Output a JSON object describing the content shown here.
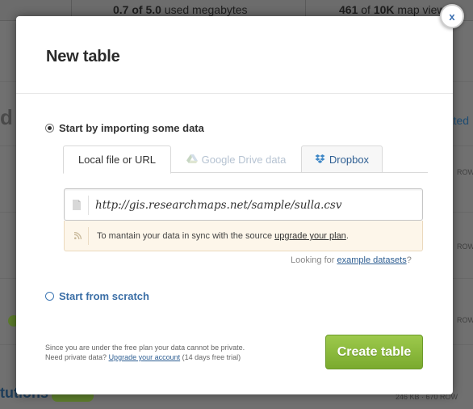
{
  "background": {
    "storage": {
      "value": "0.7 of 5.0",
      "suffix": " used megabytes"
    },
    "views": {
      "value": "461",
      "mid": " of ",
      "total": "10K",
      "suffix": " map views"
    },
    "left_fragment": "d",
    "created_fragment": "eated",
    "row_label": "ROW",
    "bottom_title": "tutions",
    "bottom_size": "246 KB · 670 ROW"
  },
  "modal": {
    "title": "New table",
    "close_label": "x",
    "import_option": {
      "label": "Start by importing some data",
      "selected": true
    },
    "tabs": [
      {
        "label": "Local file or URL",
        "icon": "none",
        "active": true
      },
      {
        "label": "Google Drive data",
        "icon": "google-drive-icon",
        "active": false
      },
      {
        "label": "Dropbox",
        "icon": "dropbox-icon",
        "active": false
      }
    ],
    "url_input": {
      "value": "http://gis.researchmaps.net/sample/sulla.csv"
    },
    "sync_notice": {
      "text": "To mantain your data in sync with the source ",
      "link": "upgrade your plan",
      "end": "."
    },
    "example_prompt": {
      "prefix": "Looking for ",
      "link": "example datasets",
      "suffix": "?"
    },
    "scratch_option": {
      "label": "Start from scratch",
      "selected": false
    },
    "footer": {
      "line1": "Since you are under the free plan your data cannot be private.",
      "line2_prefix": "Need private data? ",
      "line2_link": "Upgrade your account",
      "line2_suffix": " (14 days free trial)"
    },
    "create_button": "Create table"
  },
  "colors": {
    "accent_link": "#2f5f93",
    "create_button": "#8fbd3f",
    "overlay": "#707070",
    "notice_bg": "#fdf6ea"
  }
}
